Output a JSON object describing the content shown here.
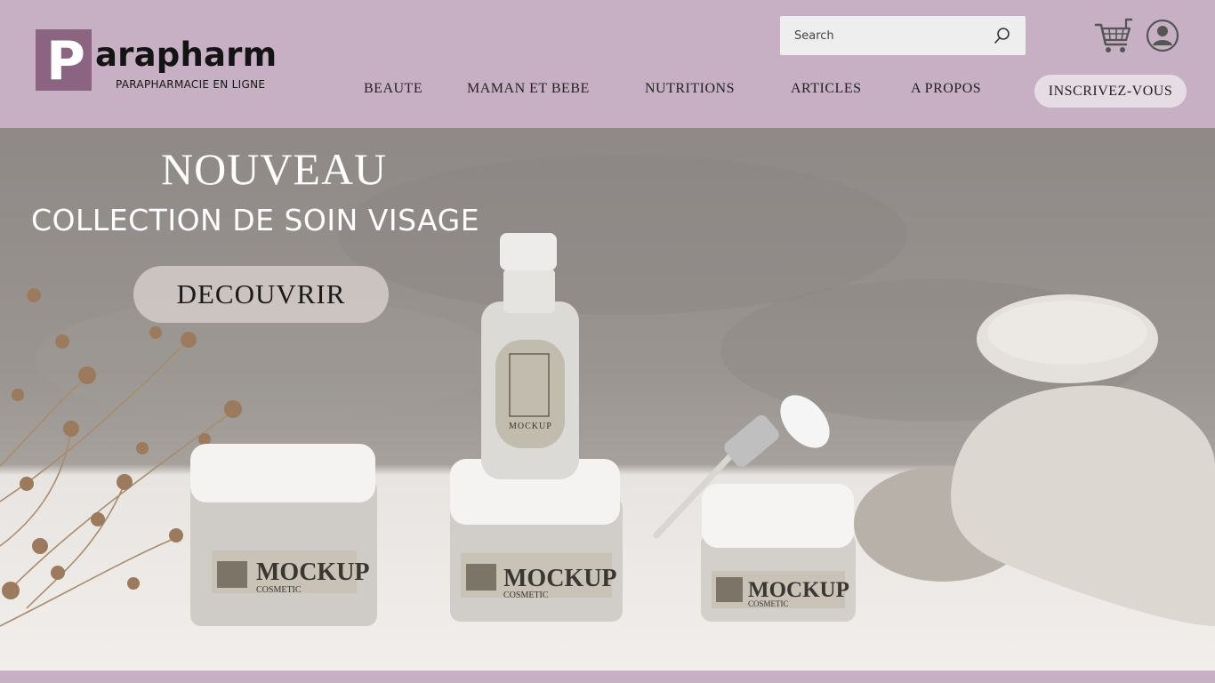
{
  "brand": {
    "logo_letter": "P",
    "logo_rest": "arapharm",
    "tagline": "PARAPHARMACIE EN LIGNE"
  },
  "search": {
    "placeholder": "Search"
  },
  "nav": {
    "items": [
      {
        "label": "BEAUTE"
      },
      {
        "label": "MAMAN ET BEBE"
      },
      {
        "label": "NUTRITIONS"
      },
      {
        "label": "ARTICLES"
      },
      {
        "label": "A PROPOS"
      }
    ],
    "signup_label": "INSCRIVEZ-VOUS"
  },
  "icons": {
    "search": "search-icon",
    "cart": "cart-icon",
    "account": "user-icon"
  },
  "hero": {
    "title": "NOUVEAU",
    "subtitle": "COLLECTION DE SOIN VISAGE",
    "cta_label": "DECOUVRIR",
    "product_label": "MOCKUP",
    "product_sublabel": "COSMETIC"
  },
  "colors": {
    "header_bg": "#c8b0c4",
    "logo_accent": "#8a6480",
    "cta_bg": "#dcd4d0"
  }
}
